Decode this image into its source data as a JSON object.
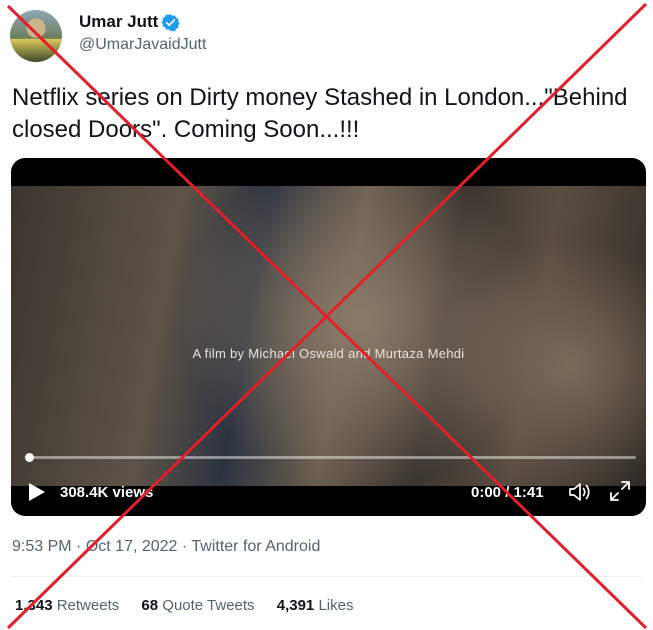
{
  "author": {
    "name": "Umar Jutt",
    "handle": "@UmarJavaidJutt",
    "verified": true
  },
  "tweet": {
    "text": "Netflix series on Dirty money Stashed in London...\"Behind closed Doors\". Coming Soon...!!!"
  },
  "video": {
    "caption": "A film by Michael Oswald and Murtaza Mehdi",
    "views": "308.4K views",
    "time": "0:00 / 1:41",
    "progress": 0
  },
  "meta": {
    "time": "9:53 PM",
    "date": "Oct 17, 2022",
    "source": "Twitter for Android",
    "separator": "·"
  },
  "stats": {
    "retweets_count": "1,343",
    "retweets_label": "Retweets",
    "quotes_count": "68",
    "quotes_label": "Quote Tweets",
    "likes_count": "4,391",
    "likes_label": "Likes"
  },
  "colors": {
    "verified": "#1d9bf0",
    "cross": "#e0202a",
    "secondary_text": "#536471"
  },
  "icons": [
    "verified-badge-icon",
    "play-icon",
    "volume-icon",
    "fullscreen-icon"
  ]
}
